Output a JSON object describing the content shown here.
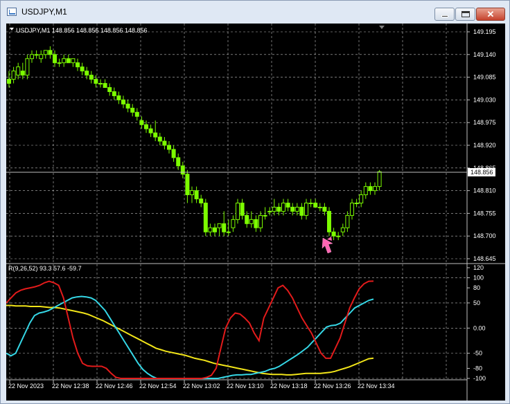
{
  "window": {
    "title": "USDJPY,M1"
  },
  "main_chart": {
    "header": "USDJPY,M1  148.856 148.856 148.856 148.856",
    "price_ticks": [
      "149.195",
      "149.140",
      "149.085",
      "149.030",
      "148.975",
      "148.920",
      "148.865",
      "148.810",
      "148.755",
      "148.700",
      "148.645"
    ],
    "current_price": "148.856"
  },
  "indicator": {
    "header": "R(9,26,52) 93.3 57.6 -59.7",
    "scale_ticks": [
      "120",
      "100",
      "80",
      "50",
      "0.00",
      "-50",
      "-80",
      "-100"
    ]
  },
  "time_labels": [
    "22 Nov 2023",
    "22 Nov 12:38",
    "22 Nov 12:46",
    "22 Nov 12:54",
    "22 Nov 13:02",
    "22 Nov 13:10",
    "22 Nov 13:18",
    "22 Nov 13:26",
    "22 Nov 13:34"
  ],
  "colors": {
    "background": "#000000",
    "candle": "#7CFC00",
    "grid": "#c0c0c0",
    "red_line": "#e31b1b",
    "cyan_line": "#35d7e6",
    "yellow_line": "#f2e519",
    "arrow": "#ff66b3"
  },
  "chart_data": {
    "type": "candlestick",
    "symbol": "USDJPY",
    "timeframe": "M1",
    "ylim": [
      148.645,
      149.195
    ],
    "candles": [
      [
        149.08,
        149.1,
        149.06,
        149.07
      ],
      [
        149.08,
        149.11,
        149.07,
        149.1
      ],
      [
        149.09,
        149.12,
        149.08,
        149.11
      ],
      [
        149.1,
        149.12,
        149.08,
        149.09
      ],
      [
        149.09,
        149.14,
        149.08,
        149.13
      ],
      [
        149.13,
        149.15,
        149.12,
        149.14
      ],
      [
        149.14,
        149.15,
        149.13,
        149.14
      ],
      [
        149.13,
        149.15,
        149.12,
        149.14
      ],
      [
        149.14,
        149.15,
        149.13,
        149.15
      ],
      [
        149.15,
        149.16,
        149.13,
        149.14
      ],
      [
        149.14,
        149.15,
        149.11,
        149.12
      ],
      [
        149.12,
        149.13,
        149.11,
        149.12
      ],
      [
        149.12,
        149.14,
        149.11,
        149.13
      ],
      [
        149.13,
        149.14,
        149.12,
        149.12
      ],
      [
        149.12,
        149.13,
        149.11,
        149.13
      ],
      [
        149.12,
        149.13,
        149.1,
        149.11
      ],
      [
        149.11,
        149.12,
        149.09,
        149.1
      ],
      [
        149.1,
        149.11,
        149.08,
        149.09
      ],
      [
        149.09,
        149.1,
        149.07,
        149.08
      ],
      [
        149.08,
        149.09,
        149.06,
        149.07
      ],
      [
        149.07,
        149.08,
        149.06,
        149.07
      ],
      [
        149.07,
        149.08,
        149.06,
        149.06
      ],
      [
        149.06,
        149.07,
        149.04,
        149.05
      ],
      [
        149.05,
        149.06,
        149.03,
        149.04
      ],
      [
        149.04,
        149.05,
        149.02,
        149.03
      ],
      [
        149.03,
        149.04,
        149.01,
        149.02
      ],
      [
        149.02,
        149.03,
        149.0,
        149.01
      ],
      [
        149.01,
        149.02,
        148.99,
        149.0
      ],
      [
        149.0,
        149.01,
        148.98,
        148.99
      ],
      [
        148.98,
        148.99,
        148.96,
        148.97
      ],
      [
        148.97,
        148.98,
        148.95,
        148.96
      ],
      [
        148.96,
        148.97,
        148.94,
        148.95
      ],
      [
        148.95,
        148.98,
        148.93,
        148.94
      ],
      [
        148.94,
        148.95,
        148.92,
        148.93
      ],
      [
        148.93,
        148.94,
        148.91,
        148.92
      ],
      [
        148.92,
        148.93,
        148.9,
        148.91
      ],
      [
        148.91,
        148.92,
        148.88,
        148.89
      ],
      [
        148.89,
        148.9,
        148.86,
        148.87
      ],
      [
        148.87,
        148.88,
        148.84,
        148.85
      ],
      [
        148.85,
        148.86,
        148.78,
        148.8
      ],
      [
        148.8,
        148.82,
        148.78,
        148.81
      ],
      [
        148.81,
        148.82,
        148.78,
        148.79
      ],
      [
        148.79,
        148.8,
        148.77,
        148.78
      ],
      [
        148.78,
        148.79,
        148.7,
        148.71
      ],
      [
        148.71,
        148.73,
        148.7,
        148.72
      ],
      [
        148.72,
        148.73,
        148.7,
        148.71
      ],
      [
        148.72,
        148.73,
        148.7,
        148.73
      ],
      [
        148.73,
        148.76,
        148.7,
        148.71
      ],
      [
        148.71,
        148.74,
        148.7,
        148.71
      ],
      [
        148.72,
        148.75,
        148.71,
        148.74
      ],
      [
        148.74,
        148.79,
        148.73,
        148.78
      ],
      [
        148.78,
        148.79,
        148.74,
        148.75
      ],
      [
        148.75,
        148.76,
        148.72,
        148.73
      ],
      [
        148.73,
        148.76,
        148.72,
        148.74
      ],
      [
        148.74,
        148.75,
        148.71,
        148.72
      ],
      [
        148.72,
        148.76,
        148.71,
        148.75
      ],
      [
        148.75,
        148.77,
        148.74,
        148.75
      ],
      [
        148.76,
        148.77,
        148.75,
        148.76
      ],
      [
        148.76,
        148.79,
        148.75,
        148.77
      ],
      [
        148.77,
        148.78,
        148.75,
        148.76
      ],
      [
        148.76,
        148.79,
        148.75,
        148.78
      ],
      [
        148.78,
        148.79,
        148.76,
        148.77
      ],
      [
        148.77,
        148.78,
        148.75,
        148.76
      ],
      [
        148.76,
        148.78,
        148.75,
        148.77
      ],
      [
        148.77,
        148.78,
        148.74,
        148.75
      ],
      [
        148.75,
        148.79,
        148.74,
        148.78
      ],
      [
        148.78,
        148.79,
        148.77,
        148.78
      ],
      [
        148.78,
        148.79,
        148.77,
        148.77
      ],
      [
        148.77,
        148.78,
        148.76,
        148.77
      ],
      [
        148.77,
        148.78,
        148.75,
        148.76
      ],
      [
        148.76,
        148.77,
        148.7,
        148.71
      ],
      [
        148.71,
        148.72,
        148.69,
        148.7
      ],
      [
        148.7,
        148.71,
        148.69,
        148.7
      ],
      [
        148.71,
        148.73,
        148.7,
        148.72
      ],
      [
        148.72,
        148.76,
        148.71,
        148.75
      ],
      [
        148.75,
        148.79,
        148.74,
        148.78
      ],
      [
        148.78,
        148.79,
        148.77,
        148.78
      ],
      [
        148.78,
        148.81,
        148.77,
        148.8
      ],
      [
        148.8,
        148.83,
        148.79,
        148.82
      ],
      [
        148.82,
        148.83,
        148.8,
        148.81
      ],
      [
        148.81,
        148.83,
        148.8,
        148.82
      ],
      [
        148.82,
        148.86,
        148.81,
        148.856
      ]
    ],
    "indicator": {
      "name": "R(9,26,52)",
      "values_shown": [
        93.3,
        57.6,
        -59.7
      ],
      "ylim": [
        -100,
        120
      ],
      "series": [
        {
          "name": "9",
          "color": "#e31b1b",
          "values": [
            50,
            60,
            70,
            75,
            78,
            80,
            82,
            85,
            90,
            93,
            90,
            85,
            60,
            20,
            -20,
            -50,
            -70,
            -75,
            -76,
            -76,
            -76,
            -80,
            -90,
            -98,
            -100,
            -100,
            -100,
            -100,
            -100,
            -100,
            -100,
            -100,
            -100,
            -100,
            -100,
            -100,
            -100,
            -100,
            -100,
            -100,
            -100,
            -100,
            -98,
            -94,
            -80,
            -40,
            0,
            20,
            30,
            28,
            20,
            10,
            -10,
            -25,
            20,
            40,
            60,
            80,
            85,
            75,
            60,
            40,
            20,
            5,
            -10,
            -30,
            -50,
            -60,
            -60,
            -40,
            -20,
            10,
            40,
            60,
            78,
            88,
            93,
            93.3
          ]
        },
        {
          "name": "26",
          "color": "#35d7e6",
          "values": [
            -50,
            -55,
            -50,
            -30,
            -10,
            10,
            25,
            30,
            32,
            35,
            40,
            45,
            50,
            55,
            60,
            62,
            63,
            62,
            60,
            55,
            45,
            35,
            20,
            5,
            -10,
            -25,
            -40,
            -55,
            -70,
            -82,
            -90,
            -96,
            -100,
            -100,
            -100,
            -100,
            -100,
            -100,
            -100,
            -100,
            -100,
            -100,
            -100,
            -100,
            -100,
            -100,
            -98,
            -96,
            -94,
            -93,
            -93,
            -92,
            -92,
            -90,
            -88,
            -86,
            -82,
            -80,
            -76,
            -70,
            -64,
            -58,
            -52,
            -45,
            -38,
            -28,
            -18,
            -8,
            2,
            5,
            6,
            10,
            20,
            30,
            40,
            45,
            50,
            55,
            57.6
          ]
        },
        {
          "name": "52",
          "color": "#f2e519",
          "values": [
            45,
            45,
            44,
            44,
            44,
            43,
            43,
            43,
            42,
            41,
            41,
            40,
            38,
            36,
            34,
            32,
            30,
            27,
            23,
            19,
            15,
            10,
            5,
            0,
            -5,
            -10,
            -15,
            -20,
            -25,
            -30,
            -35,
            -40,
            -43,
            -46,
            -48,
            -50,
            -52,
            -54,
            -57,
            -60,
            -62,
            -64,
            -67,
            -70,
            -72,
            -74,
            -76,
            -78,
            -80,
            -82,
            -84,
            -86,
            -88,
            -90,
            -91,
            -92,
            -92,
            -92,
            -93,
            -93,
            -92,
            -91,
            -90,
            -90,
            -90,
            -90,
            -89,
            -88,
            -86,
            -83,
            -80,
            -77,
            -73,
            -69,
            -65,
            -61,
            -59.7
          ]
        }
      ]
    }
  }
}
